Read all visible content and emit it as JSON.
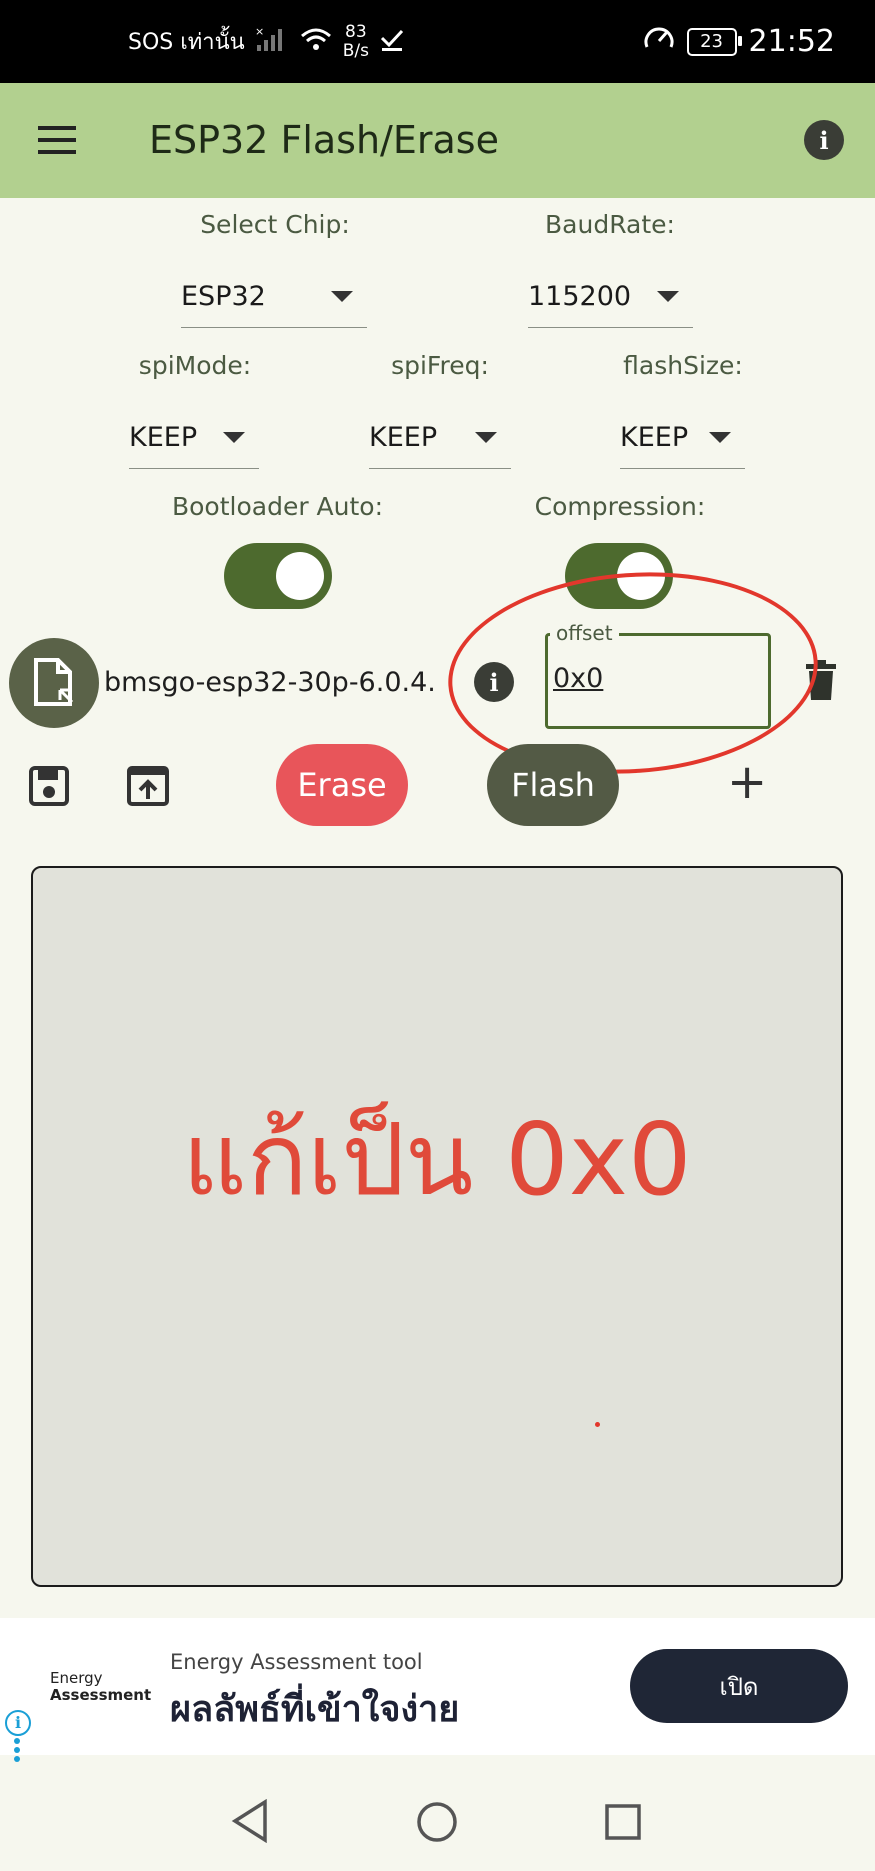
{
  "status_bar": {
    "carrier": "SOS เท่านั้น",
    "net_speed_value": "83",
    "net_speed_unit": "B/s",
    "battery": "23",
    "time": "21:52"
  },
  "app_bar": {
    "title": "ESP32 Flash/Erase",
    "menu_icon": "hamburger-icon",
    "info_icon": "info-icon"
  },
  "settings": {
    "chip_label": "Select Chip:",
    "chip_value": "ESP32",
    "baud_label": "BaudRate:",
    "baud_value": "115200",
    "spi_mode_label": "spiMode:",
    "spi_mode_value": "KEEP",
    "spi_freq_label": "spiFreq:",
    "spi_freq_value": "KEEP",
    "flash_size_label": "flashSize:",
    "flash_size_value": "KEEP",
    "bootloader_label": "Bootloader Auto:",
    "bootloader_on": true,
    "compression_label": "Compression:",
    "compression_on": true
  },
  "file_row": {
    "filename": "bmsgo-esp32-30p-6.0.4.",
    "offset_label": "offset",
    "offset_value": "0x0"
  },
  "actions": {
    "erase_label": "Erase",
    "flash_label": "Flash",
    "add_label": "+"
  },
  "log": {
    "annotation_text": "แก้เป็น 0x0"
  },
  "ad": {
    "brand_line1": "Energy",
    "brand_line2": "Assessment",
    "subtitle": "Energy Assessment tool",
    "headline": "ผลลัพธ์ที่เข้าใจง่าย",
    "cta": "เปิด"
  },
  "colors": {
    "app_bar": "#b2d08f",
    "accent": "#4d6a2e",
    "erase": "#e8555a",
    "flash": "#535a45",
    "annotation": "#e2372c"
  }
}
